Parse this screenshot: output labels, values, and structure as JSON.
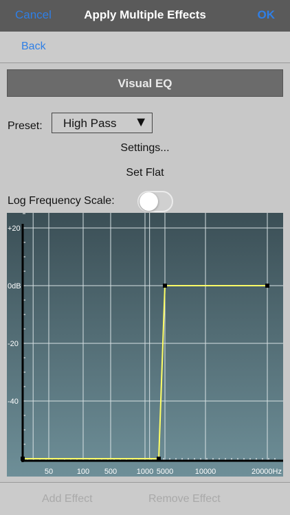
{
  "navbar": {
    "cancel_label": "Cancel",
    "title": "Apply Multiple Effects",
    "ok_label": "OK"
  },
  "back_label": "Back",
  "section": {
    "title": "Visual EQ"
  },
  "preset": {
    "label": "Preset:",
    "value": "High Pass",
    "arrow": "▼"
  },
  "settings_label": "Settings...",
  "set_flat_label": "Set Flat",
  "log_frequency": {
    "label": "Log Frequency Scale:",
    "enabled": false
  },
  "bottom_bar": {
    "add_label": "Add Effect",
    "remove_label": "Remove Effect"
  },
  "colors": {
    "accent": "#2f7fe6",
    "curve": "#ffff66",
    "graph_top": "#3b4f56",
    "graph_bottom": "#6e8f98"
  },
  "chart_data": {
    "type": "line",
    "y_tick_labels": [
      "+20",
      "0dB",
      "-20",
      "-40"
    ],
    "y_ticks": [
      20,
      0,
      -20,
      -40
    ],
    "ylim": [
      -60,
      25
    ],
    "x_tick_labels": [
      "50",
      "100",
      "500",
      "1000",
      "5000",
      "10000",
      "20000Hz"
    ],
    "x_ticks": [
      50,
      100,
      500,
      1000,
      5000,
      10000,
      20000
    ],
    "points": [
      {
        "freq": 0,
        "db": -60
      },
      {
        "freq": 4000,
        "db": -60
      },
      {
        "freq": 5000,
        "db": 0
      },
      {
        "freq": 20000,
        "db": 0
      }
    ]
  }
}
